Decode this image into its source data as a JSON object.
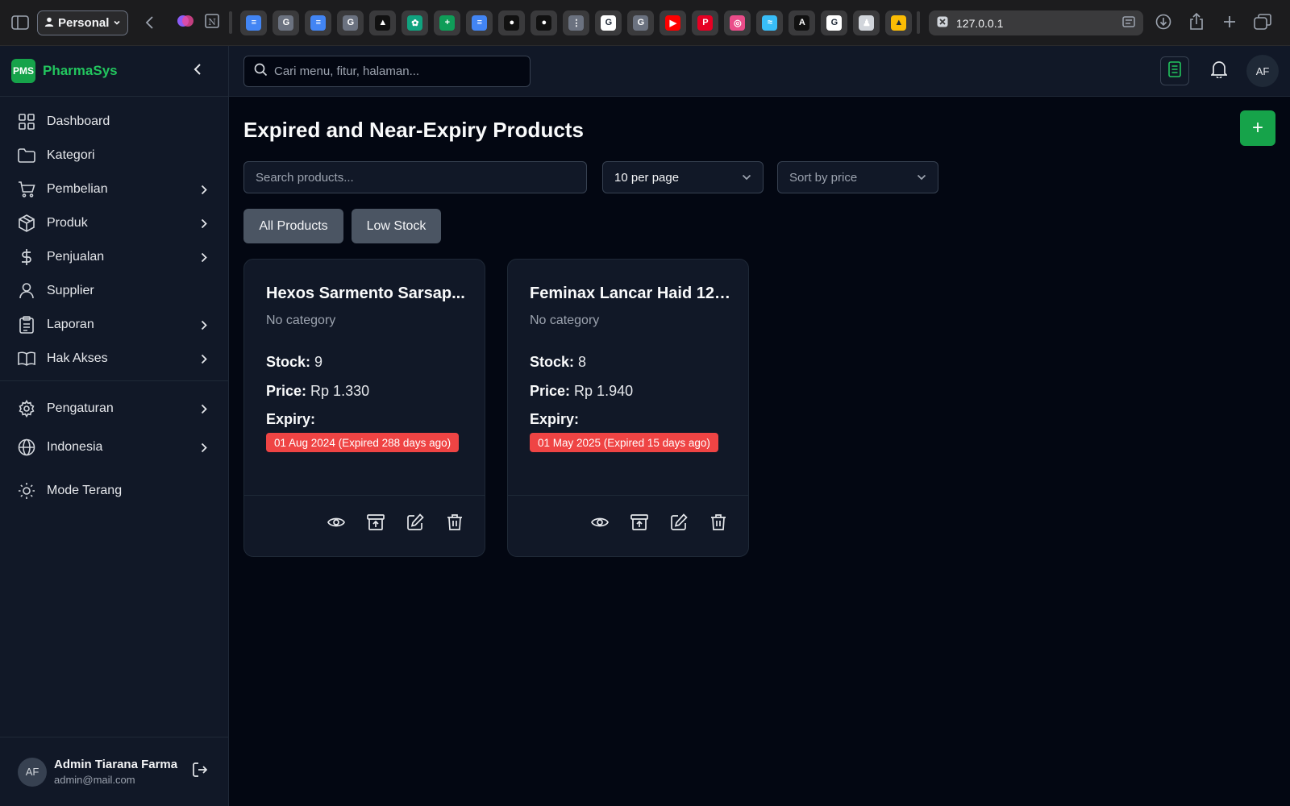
{
  "browser": {
    "profile": "Personal",
    "address": "127.0.0.1",
    "tabs": [
      {
        "icon": "docs-icon",
        "color": "#4285f4",
        "glyph": "≡"
      },
      {
        "icon": "grammarly-icon",
        "color": "#6b7280",
        "glyph": "G"
      },
      {
        "icon": "docs-icon",
        "color": "#4285f4",
        "glyph": "≡"
      },
      {
        "icon": "grammarly-icon",
        "color": "#6b7280",
        "glyph": "G"
      },
      {
        "icon": "app-icon",
        "color": "#111111",
        "glyph": "▲"
      },
      {
        "icon": "chatgpt-icon",
        "color": "#10a37f",
        "glyph": "✿"
      },
      {
        "icon": "sheets-icon",
        "color": "#0f9d58",
        "glyph": "+"
      },
      {
        "icon": "docs-icon",
        "color": "#4285f4",
        "glyph": "≡"
      },
      {
        "icon": "github-icon",
        "color": "#111111",
        "glyph": "●"
      },
      {
        "icon": "github-icon",
        "color": "#111111",
        "glyph": "●"
      },
      {
        "icon": "app-icon",
        "color": "#6b7280",
        "glyph": "⋮"
      },
      {
        "icon": "google-icon",
        "color": "#ffffff",
        "glyph": "G"
      },
      {
        "icon": "grammarly-icon",
        "color": "#6b7280",
        "glyph": "G"
      },
      {
        "icon": "youtube-icon",
        "color": "#ff0000",
        "glyph": "▶"
      },
      {
        "icon": "pinterest-icon",
        "color": "#e60023",
        "glyph": "P"
      },
      {
        "icon": "dribbble-icon",
        "color": "#ea4c89",
        "glyph": "◎"
      },
      {
        "icon": "tailwind-icon",
        "color": "#38bdf8",
        "glyph": "≈"
      },
      {
        "icon": "anthropic-icon",
        "color": "#111111",
        "glyph": "A"
      },
      {
        "icon": "google-icon",
        "color": "#ffffff",
        "glyph": "G"
      },
      {
        "icon": "app-icon",
        "color": "#d1d5db",
        "glyph": "♟"
      },
      {
        "icon": "drive-icon",
        "color": "#fbbc04",
        "glyph": "▲"
      }
    ]
  },
  "sidebar": {
    "brand_logo": "PMS",
    "brand_name": "PharmaSys",
    "items": [
      {
        "label": "Dashboard"
      },
      {
        "label": "Kategori"
      },
      {
        "label": "Pembelian"
      },
      {
        "label": "Produk"
      },
      {
        "label": "Penjualan"
      },
      {
        "label": "Supplier"
      },
      {
        "label": "Laporan"
      },
      {
        "label": "Hak Akses"
      }
    ],
    "settings": "Pengaturan",
    "language": "Indonesia",
    "theme": "Mode Terang",
    "user": {
      "initials": "AF",
      "name": "Admin Tiarana Farma",
      "email": "admin@mail.com"
    }
  },
  "header": {
    "search_placeholder": "Cari menu, fitur, halaman...",
    "avatar": "AF"
  },
  "main": {
    "title": "Expired and Near-Expiry Products",
    "add_label": "+",
    "search_placeholder": "Search products...",
    "per_page": "10 per page",
    "sort": "Sort by price",
    "filters": [
      "All Products",
      "Low Stock"
    ],
    "stock_label": "Stock:",
    "price_label": "Price:",
    "expiry_label": "Expiry:",
    "products": [
      {
        "name": "Hexos Sarmento Sarsap...",
        "category": "No category",
        "stock": "9",
        "price": "Rp 1.330",
        "expiry": "01 Aug 2024 (Expired 288 days ago)"
      },
      {
        "name": "Feminax Lancar Haid 12 ...",
        "category": "No category",
        "stock": "8",
        "price": "Rp 1.940",
        "expiry": "01 May 2025 (Expired 15 days ago)"
      }
    ]
  },
  "colors": {
    "accent": "#16a34a",
    "brand": "#22c55e",
    "danger": "#ef4444",
    "background": "#030712",
    "panel": "#111827"
  }
}
